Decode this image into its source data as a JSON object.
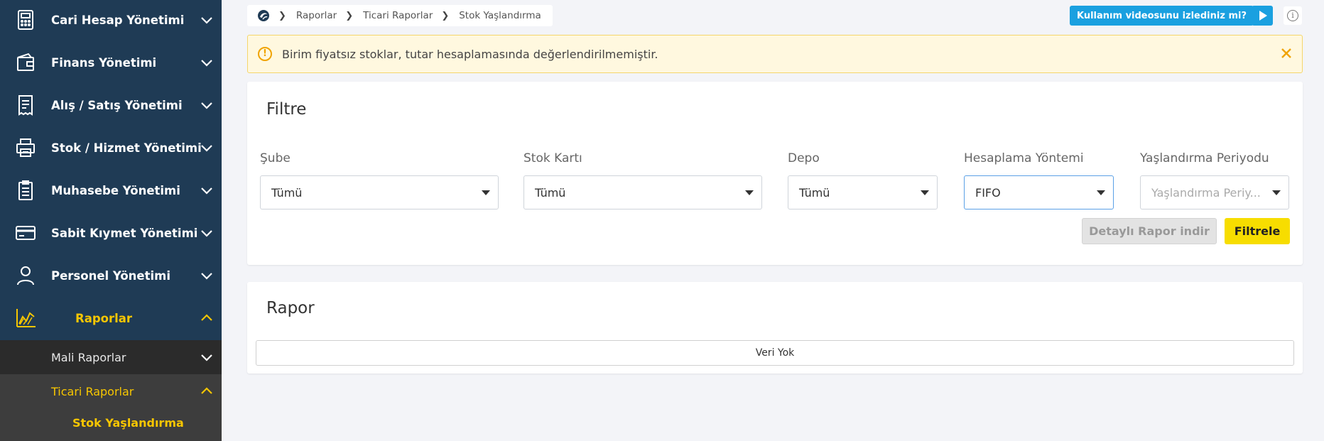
{
  "sidebar": {
    "items": [
      {
        "label": "Cari Hesap Yönetimi",
        "icon": "calculator-icon"
      },
      {
        "label": "Finans Yönetimi",
        "icon": "wallet-icon"
      },
      {
        "label": "Alış / Satış Yönetimi",
        "icon": "receipt-icon"
      },
      {
        "label": "Stok / Hizmet Yönetimi",
        "icon": "printer-box-icon"
      },
      {
        "label": "Muhasebe Yönetimi",
        "icon": "clipboard-icon"
      },
      {
        "label": "Sabit Kıymet Yönetimi",
        "icon": "credit-card-icon"
      },
      {
        "label": "Personel Yönetimi",
        "icon": "person-icon"
      },
      {
        "label": "Raporlar",
        "icon": "chart-icon"
      }
    ],
    "sub_items": [
      {
        "label": "Mali Raporlar"
      },
      {
        "label": "Ticari Raporlar"
      }
    ],
    "active_leaf": "Stok Yaşlandırma"
  },
  "breadcrumb": {
    "items": [
      "Raporlar",
      "Ticari Raporlar",
      "Stok Yaşlandırma"
    ]
  },
  "help": {
    "video_label": "Kullanım videosunu izlediniz mi?"
  },
  "alert": {
    "text": "Birim fiyatsız stoklar, tutar hesaplamasında değerlendirilmemiştir."
  },
  "filter": {
    "title": "Filtre",
    "fields": [
      {
        "label": "Şube",
        "value": "Tümü"
      },
      {
        "label": "Stok Kartı",
        "value": "Tümü"
      },
      {
        "label": "Depo",
        "value": "Tümü"
      },
      {
        "label": "Hesaplama Yöntemi",
        "value": "FIFO"
      },
      {
        "label": "Yaşlandırma Periyodu",
        "placeholder": "Yaşlandırma Periy..."
      }
    ],
    "detail_button": "Detaylı Rapor indir",
    "filter_button": "Filtrele"
  },
  "report": {
    "title": "Rapor",
    "empty_text": "Veri Yok"
  },
  "colors": {
    "sidebar_bg": "#1f3b55",
    "accent": "#f7c600",
    "info_blue": "#1aa0e0",
    "alert_bg": "#fff8df",
    "filter_btn": "#f7dd00"
  }
}
